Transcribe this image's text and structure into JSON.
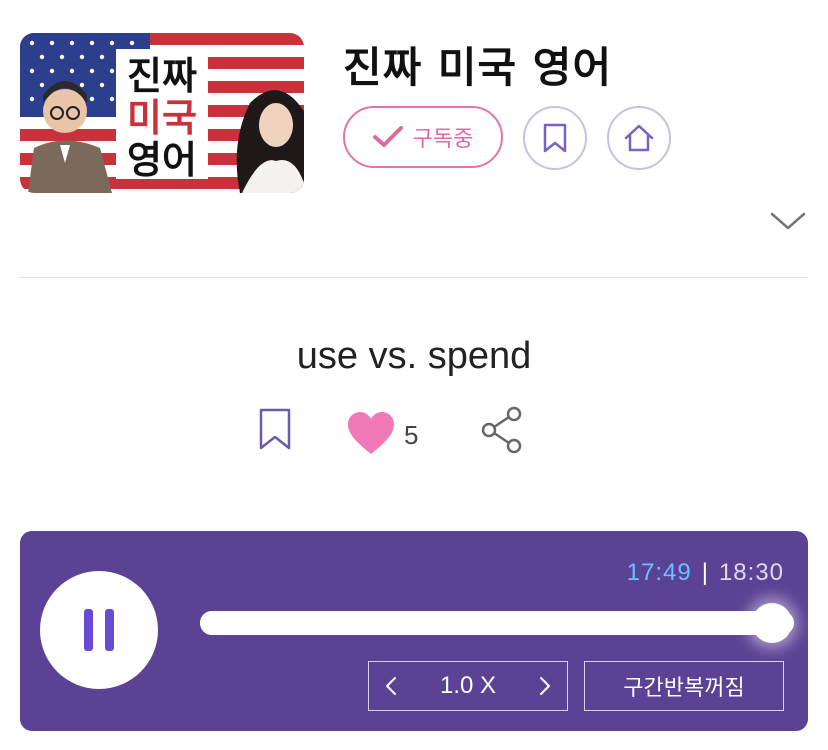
{
  "program": {
    "title": "진짜 미국 영어",
    "thumbnail_text": [
      "진짜",
      "미국",
      "영어"
    ],
    "subscribe_label": "구독중"
  },
  "episode": {
    "title": "use vs. spend",
    "like_count": "5"
  },
  "player": {
    "current_time": "17:49",
    "separator": "|",
    "total_time": "18:30",
    "progress": 0.963,
    "speed": "1.0 X",
    "repeat_label": "구간반복꺼짐"
  },
  "colors": {
    "accent_pink": "#e0699f",
    "player_bg": "#5c4294",
    "time_current": "#66c3ff",
    "pause_icon": "#6a4bd6"
  },
  "icons": [
    "check-icon",
    "bookmark-icon",
    "home-icon",
    "chevron-down-icon",
    "heart-icon",
    "share-icon",
    "pause-icon",
    "chevron-left-icon",
    "chevron-right-icon"
  ]
}
